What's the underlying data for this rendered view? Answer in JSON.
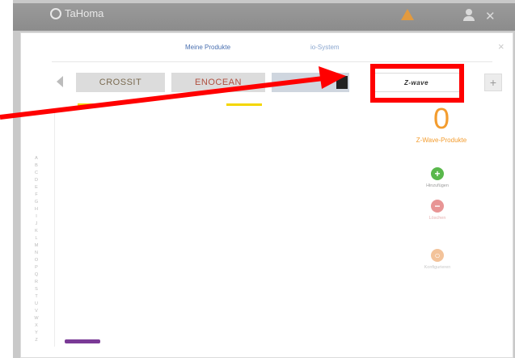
{
  "app": {
    "name": "TaHoma"
  },
  "dialog": {
    "tabs": [
      {
        "label": "Meine Produkte"
      },
      {
        "label": "io-System"
      }
    ],
    "close_label": "×"
  },
  "brands": [
    {
      "label": "CROSSIT"
    },
    {
      "label": "ENOCEAN"
    },
    {
      "label": ""
    },
    {
      "label": "Z-wave"
    }
  ],
  "nav": {
    "plus_label": "+"
  },
  "alpha_index": [
    "A",
    "B",
    "C",
    "D",
    "E",
    "F",
    "G",
    "H",
    "I",
    "J",
    "K",
    "L",
    "M",
    "N",
    "O",
    "P",
    "Q",
    "R",
    "S",
    "T",
    "U",
    "V",
    "W",
    "X",
    "Y",
    "Z"
  ],
  "summary": {
    "count": "0",
    "label": "Z-Wave-Produkte"
  },
  "actions": {
    "add": "Hinzufügen",
    "remove": "Löschen",
    "config": "Konfigurieren"
  },
  "colors": {
    "highlight": "#ff0000",
    "accent": "#f39c2e",
    "add": "#59b84b"
  }
}
